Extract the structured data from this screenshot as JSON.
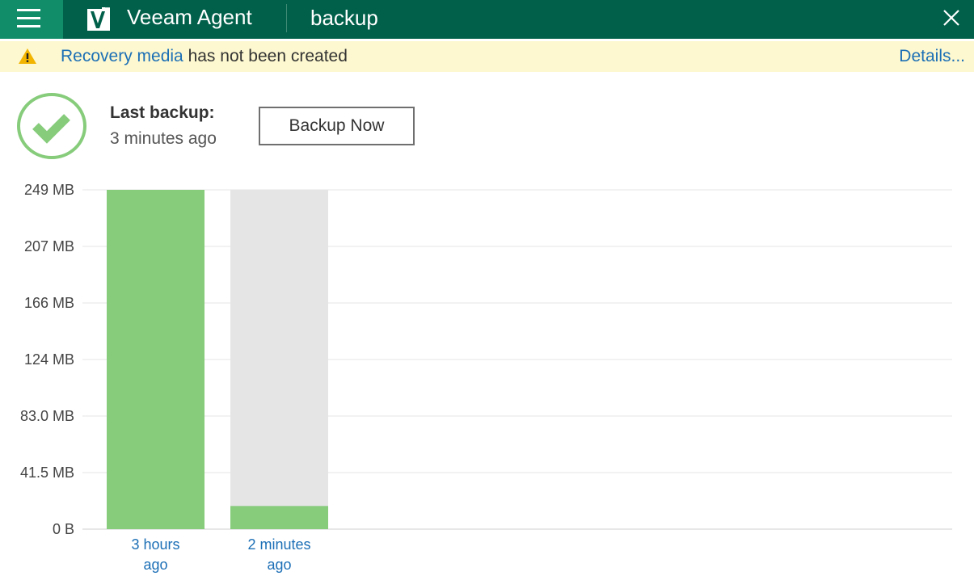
{
  "titlebar": {
    "app_name": "Veeam Agent",
    "job_name": "backup",
    "menu_icon": "hamburger-icon",
    "logo_icon": "veeam-logo-icon",
    "close_icon": "close-icon",
    "background_color": "#00604a",
    "menu_accent_color": "#128d6a"
  },
  "warning": {
    "icon": "warning-triangle-icon",
    "link_text": "Recovery media",
    "message": " has not been created",
    "details_label": "Details...",
    "background_color": "#fdf8cf"
  },
  "status": {
    "icon": "success-check-icon",
    "last_backup_label": "Last backup:",
    "last_backup_value": "3 minutes ago",
    "backup_now_label": "Backup Now"
  },
  "chart_data": {
    "type": "bar",
    "y_ticks": [
      "249 MB",
      "207 MB",
      "166 MB",
      "124 MB",
      "83.0 MB",
      "41.5 MB",
      "0 B"
    ],
    "ylim": [
      0,
      249
    ],
    "unit": "MB",
    "categories": [
      {
        "line1": "3 hours",
        "line2": "ago"
      },
      {
        "line1": "2 minutes",
        "line2": "ago"
      }
    ],
    "values": [
      249,
      17
    ],
    "capacity": [
      249,
      249
    ],
    "bar_color": "#86cc7b",
    "capacity_color": "#e6e5e5",
    "grid": true
  }
}
